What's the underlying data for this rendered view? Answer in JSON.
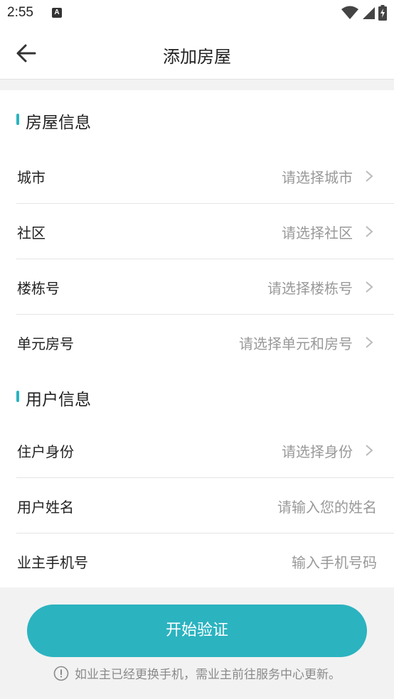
{
  "status_bar": {
    "time": "2:55",
    "notification_icon": "a-notification-icon",
    "icons": [
      "wifi-icon",
      "signal-icon",
      "battery-charging-icon"
    ]
  },
  "header": {
    "back_icon": "arrow-left-icon",
    "title": "添加房屋"
  },
  "house_section": {
    "title": "房屋信息",
    "rows": [
      {
        "label": "城市",
        "value": "请选择城市"
      },
      {
        "label": "社区",
        "value": "请选择社区"
      },
      {
        "label": "楼栋号",
        "value": "请选择楼栋号"
      },
      {
        "label": "单元房号",
        "value": "请选择单元和房号"
      }
    ]
  },
  "user_section": {
    "title": "用户信息",
    "rows": [
      {
        "label": "住户身份",
        "value": "请选择身份"
      },
      {
        "label": "用户姓名",
        "placeholder": "请输入您的姓名"
      },
      {
        "label": "业主手机号",
        "placeholder": "输入手机号码"
      }
    ]
  },
  "actions": {
    "submit_label": "开始验证"
  },
  "notice": {
    "icon": "exclamation-circle-icon",
    "text": "如业主已经更换手机，需业主前往服务中心更新。"
  },
  "colors": {
    "accent": "#2bb3c0",
    "background": "#f2f2f2",
    "placeholder": "#999999"
  }
}
